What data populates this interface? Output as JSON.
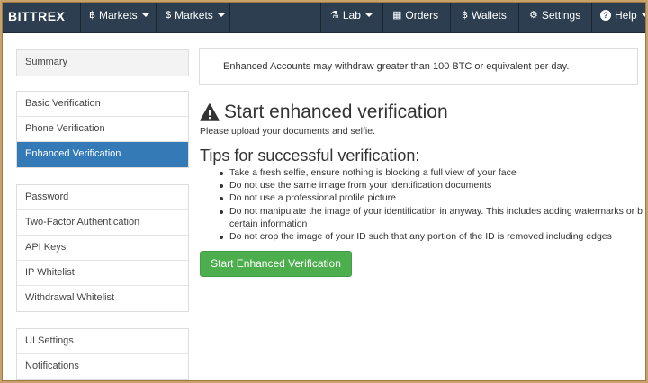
{
  "navbar": {
    "brand": "BITTREX",
    "items": [
      {
        "icon": "bitcoin-icon",
        "glyph": "฿",
        "label": "Markets",
        "dropdown": true
      },
      {
        "icon": "dollar-icon",
        "glyph": "$",
        "label": "Markets",
        "dropdown": true
      },
      {
        "icon": "flask-icon",
        "glyph": "⚗",
        "label": "Lab",
        "dropdown": true
      },
      {
        "icon": "calendar-icon",
        "glyph": "▦",
        "label": "Orders",
        "dropdown": false
      },
      {
        "icon": "bitcoin-icon",
        "glyph": "฿",
        "label": "Wallets",
        "dropdown": false
      },
      {
        "icon": "gear-icon",
        "glyph": "⚙",
        "label": "Settings",
        "dropdown": false
      },
      {
        "icon": "question-icon",
        "glyph": "?",
        "label": "Help",
        "dropdown": true
      }
    ]
  },
  "sidebar": {
    "groups": [
      [
        {
          "label": "Summary"
        }
      ],
      [
        {
          "label": "Basic Verification"
        },
        {
          "label": "Phone Verification"
        },
        {
          "label": "Enhanced Verification",
          "active": true
        }
      ],
      [
        {
          "label": "Password"
        },
        {
          "label": "Two-Factor Authentication"
        },
        {
          "label": "API Keys"
        },
        {
          "label": "IP Whitelist"
        },
        {
          "label": "Withdrawal Whitelist"
        }
      ],
      [
        {
          "label": "UI Settings"
        },
        {
          "label": "Notifications"
        }
      ]
    ]
  },
  "main": {
    "alert": "Enhanced Accounts may withdraw greater than 100 BTC or equivalent per day.",
    "title": "Start enhanced verification",
    "subtitle": "Please upload your documents and selfie.",
    "tips_title": "Tips for successful verification:",
    "tips": [
      "Take a fresh selfie, ensure nothing is blocking a full view of your face",
      "Do not use the same image from your identification documents",
      "Do not use a professional profile picture",
      "Do not manipulate the image of your identification in anyway. This includes adding watermarks or b\ncertain information",
      "Do not crop the image of your ID such that any portion of the ID is removed including edges"
    ],
    "button": "Start Enhanced Verification"
  },
  "colors": {
    "navbar": "#2c3e50",
    "active": "#337ab7",
    "button": "#4cae4c",
    "frame": "#c8a26a"
  }
}
